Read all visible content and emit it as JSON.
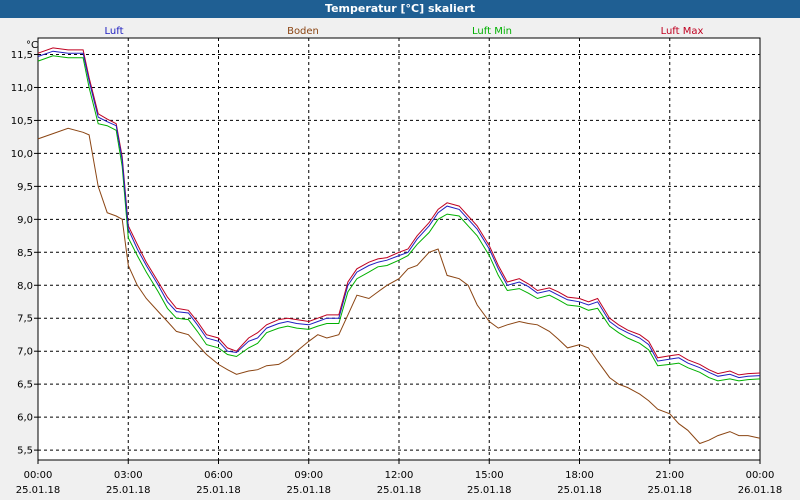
{
  "window": {
    "title": "Temperatur [°C] skaliert"
  },
  "chart_data": {
    "type": "line",
    "title": "Temperatur [°C] skaliert",
    "ylabel": "°C",
    "ylim": [
      5.35,
      11.75
    ],
    "xlim": [
      0,
      24
    ],
    "yticks": [
      "5,5",
      "6,0",
      "6,5",
      "7,0",
      "7,5",
      "8,0",
      "8,5",
      "9,0",
      "9,5",
      "10,0",
      "10,5",
      "11,0",
      "11,5"
    ],
    "ytick_values": [
      5.5,
      6.0,
      6.5,
      7.0,
      7.5,
      8.0,
      8.5,
      9.0,
      9.5,
      10.0,
      10.5,
      11.0,
      11.5
    ],
    "xticks": [
      {
        "time": "00:00",
        "date": "25.01.18",
        "h": 0
      },
      {
        "time": "03:00",
        "date": "25.01.18",
        "h": 3
      },
      {
        "time": "06:00",
        "date": "25.01.18",
        "h": 6
      },
      {
        "time": "09:00",
        "date": "25.01.18",
        "h": 9
      },
      {
        "time": "12:00",
        "date": "25.01.18",
        "h": 12
      },
      {
        "time": "15:00",
        "date": "25.01.18",
        "h": 15
      },
      {
        "time": "18:00",
        "date": "25.01.18",
        "h": 18
      },
      {
        "time": "21:00",
        "date": "25.01.18",
        "h": 21
      },
      {
        "time": "00:00",
        "date": "26.01.18",
        "h": 24
      }
    ],
    "grid": true,
    "legend_position": "top",
    "x": [
      0,
      0.5,
      1,
      1.5,
      1.7,
      2,
      2.3,
      2.6,
      2.8,
      3,
      3.3,
      3.6,
      4,
      4.3,
      4.6,
      5,
      5.3,
      5.6,
      6,
      6.3,
      6.6,
      7,
      7.3,
      7.6,
      8,
      8.3,
      8.6,
      9,
      9.3,
      9.6,
      10,
      10.3,
      10.6,
      11,
      11.3,
      11.6,
      12,
      12.3,
      12.6,
      13,
      13.3,
      13.6,
      14,
      14.3,
      14.6,
      15,
      15.3,
      15.6,
      16,
      16.3,
      16.6,
      17,
      17.3,
      17.6,
      18,
      18.3,
      18.6,
      19,
      19.3,
      19.6,
      20,
      20.3,
      20.6,
      21,
      21.3,
      21.6,
      22,
      22.3,
      22.6,
      23,
      23.3,
      23.6,
      24
    ],
    "series": [
      {
        "name": "Luft",
        "color": "#2020c0",
        "values": [
          11.47,
          11.55,
          11.52,
          11.52,
          11.1,
          10.55,
          10.48,
          10.42,
          9.9,
          8.85,
          8.55,
          8.3,
          8.0,
          7.75,
          7.6,
          7.58,
          7.4,
          7.2,
          7.15,
          7.0,
          6.98,
          7.15,
          7.2,
          7.35,
          7.42,
          7.45,
          7.42,
          7.4,
          7.45,
          7.5,
          7.5,
          8.0,
          8.2,
          8.3,
          8.35,
          8.38,
          8.45,
          8.5,
          8.7,
          8.9,
          9.1,
          9.2,
          9.15,
          9.0,
          8.85,
          8.55,
          8.25,
          8.0,
          8.05,
          7.98,
          7.88,
          7.92,
          7.85,
          7.78,
          7.75,
          7.7,
          7.75,
          7.45,
          7.35,
          7.28,
          7.2,
          7.1,
          6.85,
          6.88,
          6.9,
          6.82,
          6.75,
          6.68,
          6.62,
          6.65,
          6.6,
          6.62,
          6.63
        ]
      },
      {
        "name": "Boden",
        "color": "#8b4513",
        "values": [
          10.22,
          10.3,
          10.38,
          10.32,
          10.28,
          9.5,
          9.1,
          9.05,
          9.0,
          8.3,
          8.0,
          7.8,
          7.6,
          7.45,
          7.3,
          7.25,
          7.1,
          6.95,
          6.8,
          6.72,
          6.65,
          6.7,
          6.72,
          6.78,
          6.8,
          6.88,
          7.0,
          7.15,
          7.25,
          7.2,
          7.25,
          7.55,
          7.85,
          7.8,
          7.9,
          8.0,
          8.1,
          8.25,
          8.3,
          8.5,
          8.55,
          8.15,
          8.1,
          8.0,
          7.7,
          7.45,
          7.35,
          7.4,
          7.45,
          7.42,
          7.4,
          7.3,
          7.18,
          7.05,
          7.1,
          7.05,
          6.85,
          6.6,
          6.5,
          6.45,
          6.35,
          6.25,
          6.12,
          6.05,
          5.9,
          5.8,
          5.6,
          5.65,
          5.72,
          5.78,
          5.72,
          5.72,
          5.68
        ]
      },
      {
        "name": "Luft Min",
        "color": "#00b000",
        "values": [
          11.4,
          11.48,
          11.45,
          11.45,
          11.0,
          10.45,
          10.42,
          10.35,
          9.8,
          8.72,
          8.45,
          8.2,
          7.9,
          7.65,
          7.5,
          7.48,
          7.3,
          7.1,
          7.05,
          6.95,
          6.92,
          7.05,
          7.12,
          7.28,
          7.35,
          7.38,
          7.35,
          7.33,
          7.38,
          7.42,
          7.42,
          7.9,
          8.1,
          8.2,
          8.28,
          8.3,
          8.38,
          8.45,
          8.62,
          8.8,
          9.0,
          9.08,
          9.05,
          8.9,
          8.75,
          8.45,
          8.15,
          7.92,
          7.95,
          7.88,
          7.8,
          7.85,
          7.78,
          7.7,
          7.68,
          7.62,
          7.65,
          7.38,
          7.28,
          7.2,
          7.12,
          7.02,
          6.78,
          6.8,
          6.82,
          6.75,
          6.68,
          6.6,
          6.55,
          6.58,
          6.55,
          6.57,
          6.58
        ]
      },
      {
        "name": "Luft Max",
        "color": "#c00020",
        "values": [
          11.52,
          11.6,
          11.57,
          11.57,
          11.15,
          10.6,
          10.52,
          10.45,
          9.95,
          8.9,
          8.62,
          8.35,
          8.05,
          7.82,
          7.65,
          7.62,
          7.45,
          7.25,
          7.2,
          7.05,
          7.0,
          7.2,
          7.28,
          7.4,
          7.48,
          7.5,
          7.48,
          7.45,
          7.5,
          7.55,
          7.55,
          8.05,
          8.25,
          8.35,
          8.4,
          8.42,
          8.5,
          8.55,
          8.75,
          8.95,
          9.15,
          9.25,
          9.2,
          9.05,
          8.9,
          8.6,
          8.3,
          8.05,
          8.1,
          8.02,
          7.92,
          7.96,
          7.9,
          7.82,
          7.8,
          7.75,
          7.8,
          7.5,
          7.4,
          7.32,
          7.25,
          7.15,
          6.9,
          6.93,
          6.95,
          6.87,
          6.8,
          6.72,
          6.66,
          6.7,
          6.64,
          6.66,
          6.67
        ]
      }
    ]
  }
}
